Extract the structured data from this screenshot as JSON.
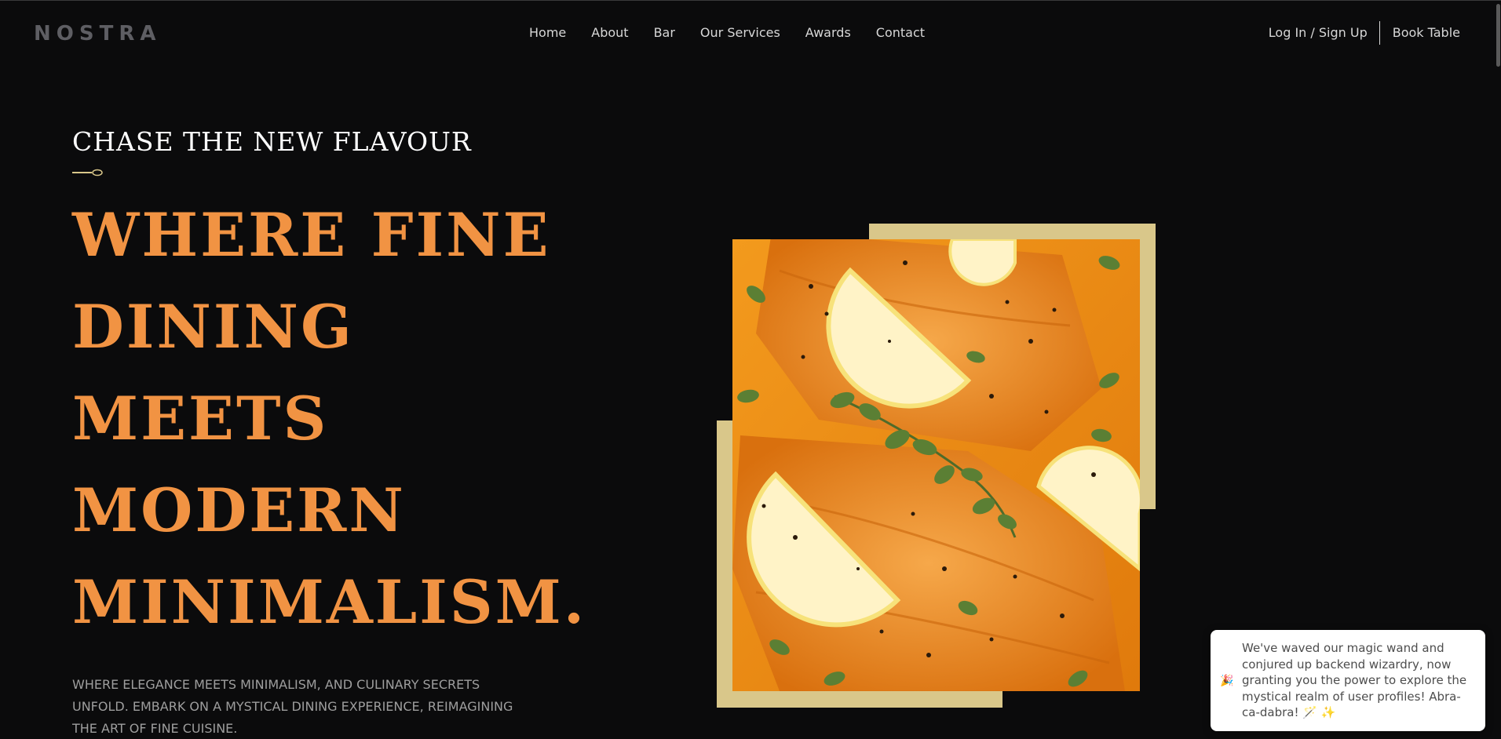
{
  "header": {
    "logo": "NOSTRA",
    "nav": [
      {
        "label": "Home"
      },
      {
        "label": "About"
      },
      {
        "label": "Bar"
      },
      {
        "label": "Our Services"
      },
      {
        "label": "Awards"
      },
      {
        "label": "Contact"
      }
    ],
    "login_label": "Log In / Sign Up",
    "book_label": "Book Table"
  },
  "hero": {
    "eyebrow": "CHASE THE NEW FLAVOUR",
    "headline_lines": [
      "WHERE FINE",
      "DINING",
      "MEETS",
      "MODERN",
      "MINIMALISM."
    ],
    "subtext": "WHERE ELEGANCE MEETS MINIMALISM, AND CULINARY SECRETS UNFOLD. EMBARK ON A MYSTICAL DINING EXPERIENCE, REIMAGINING THE ART OF FINE CUISINE.",
    "image_icon": "salmon-dish-photo"
  },
  "toast": {
    "icon": "party-popper-icon",
    "icon_glyph": "🎉",
    "message": "We've waved our magic wand and conjured up backend wizardry, now granting you the power to explore the mystical realm of user profiles! Abra-ca-dabra! 🪄 ✨"
  },
  "colors": {
    "background": "#0b0b0c",
    "accent": "#f19343",
    "frame": "#d9c78a",
    "nav_text": "#d7d7d7",
    "logo": "#5e5e63"
  }
}
